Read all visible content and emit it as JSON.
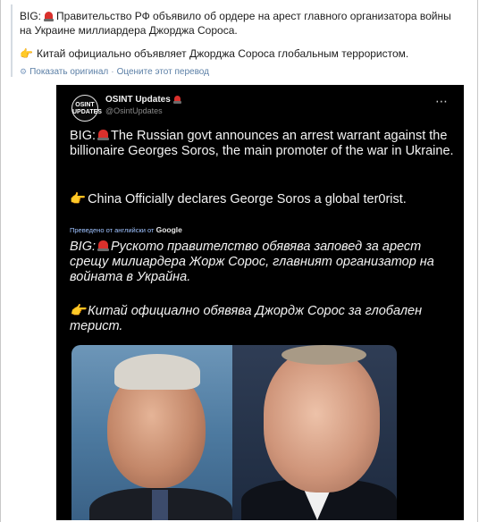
{
  "translation": {
    "line1_prefix": "BIG:",
    "line1_text": "Правительство РФ объявило об ордере на арест главного организатора войны на Украине миллиардера Джорджа Сороса.",
    "line2_text": "Китай официально объявляет Джорджа Сороса глобальным террористом.",
    "show_original": "Показать оригинал",
    "rate_translation": "Оцените этот перевод",
    "separator": "·"
  },
  "tweet": {
    "avatar_text": "OSINT UPDATES",
    "display_name": "OSINT Updates",
    "handle": "@OsintUpdates",
    "more_icon": "⋯",
    "main_prefix": "BIG:",
    "main_text": "The Russian govt announces an arrest warrant against the billionaire Georges Soros, the main promoter of the war in Ukraine.",
    "china_text": "China Officially declares George Soros a global ter0rist.",
    "google_note": "Преведено от английски от",
    "google_brand": "Google",
    "bg_prefix": "BIG:",
    "bg_text": "Руското правителство обявява заповед за арест срещу милиардера Жорж Сорос, главният организатор на войната в Украйна.",
    "bg_china_text": "Китай официално обявява Джордж Сорос за глобален терист."
  },
  "icons": {
    "siren": "police-siren-icon",
    "hand": "pointing-hand-icon",
    "gear": "gear-icon"
  },
  "colors": {
    "link": "#5b7fa6",
    "tweet_bg": "#000000",
    "siren_red": "#d9302c"
  }
}
